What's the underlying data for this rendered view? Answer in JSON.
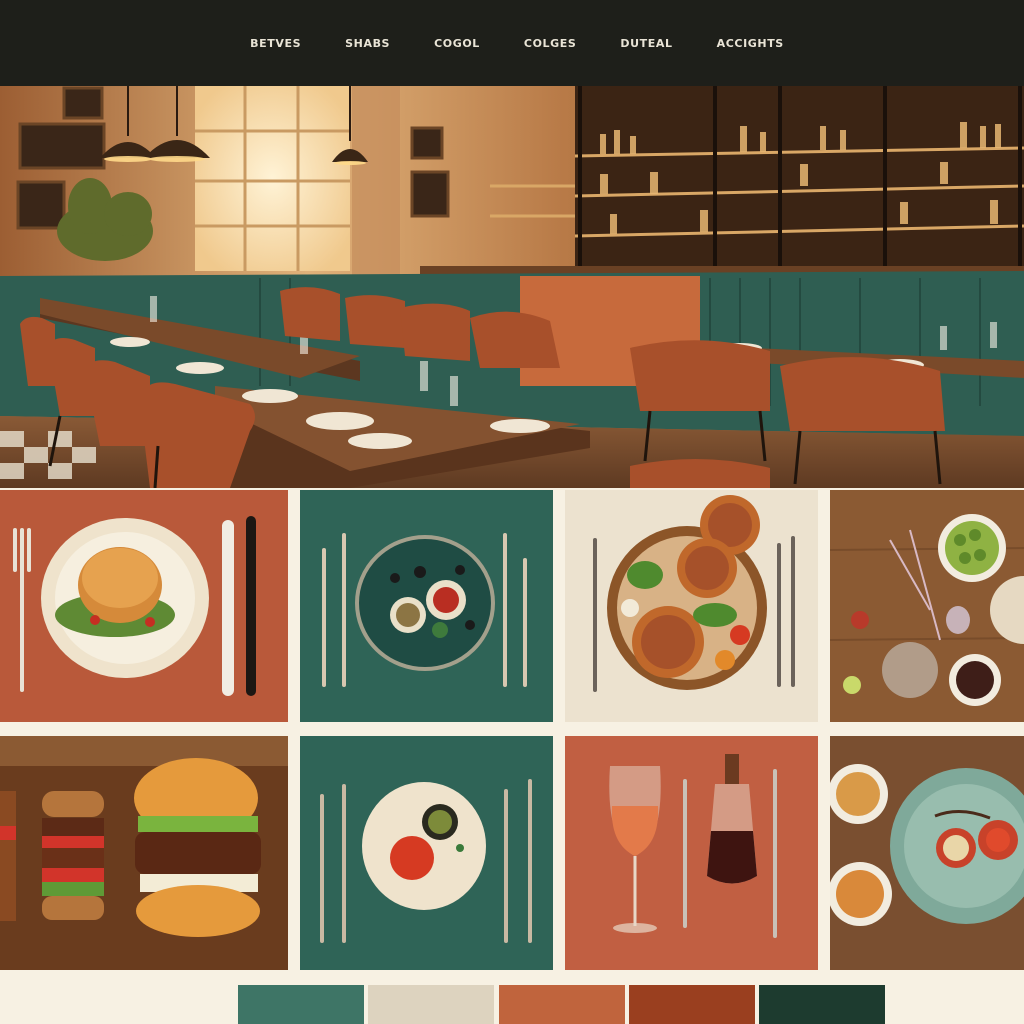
{
  "nav": {
    "items": [
      "BETVES",
      "SHABS",
      "COGOL",
      "COLGES",
      "DUTEAL",
      "ACCIGHTS"
    ]
  },
  "palette": {
    "swatches": [
      "#3e7566",
      "#ddd3bf",
      "#c0643d",
      "#9a3f1f",
      "#1d3b2f"
    ]
  },
  "colors": {
    "nav_background": "#1e1f1a",
    "nav_text": "#e9e4d6",
    "page_background": "#f7f1e3",
    "terracotta": "#b9593a",
    "teal": "#2f6457",
    "cream": "#ece2cf",
    "wood": "#8b5a33"
  },
  "gallery": {
    "tiles": [
      {
        "name": "burger-plate-tile",
        "background": "#b9593a"
      },
      {
        "name": "small-plates-tile",
        "background": "#2f6457"
      },
      {
        "name": "pies-platter-tile",
        "background": "#ece2cf"
      },
      {
        "name": "wood-table-sides-tile",
        "background": "#8b5a33"
      },
      {
        "name": "burgers-board-tile",
        "background": "#8b5a33"
      },
      {
        "name": "tomato-plate-tile",
        "background": "#2f6457"
      },
      {
        "name": "wine-tile",
        "background": "#c15f42"
      },
      {
        "name": "appetizer-bowls-tile",
        "background": "#7a4f30"
      }
    ]
  }
}
